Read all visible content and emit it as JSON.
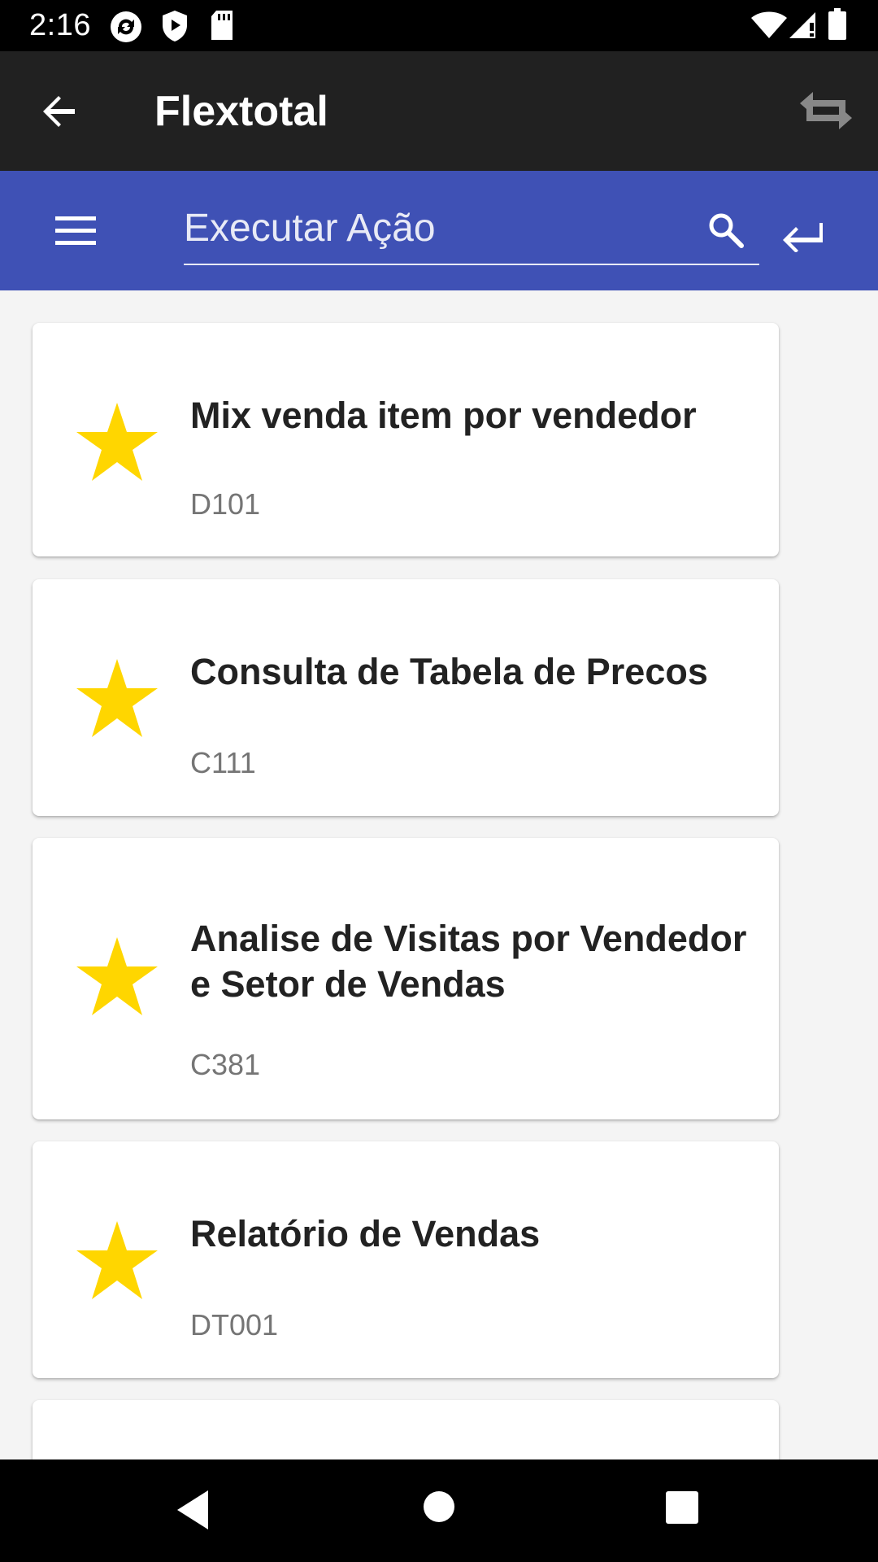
{
  "status_bar": {
    "time": "2:16",
    "left_icons": [
      "sync-app-icon",
      "shield-icon",
      "sd-card-icon"
    ],
    "right_icons": [
      "wifi-icon",
      "signal-icon",
      "battery-icon"
    ]
  },
  "app_bar": {
    "title": "Flextotal",
    "back_icon": "arrow-left-icon",
    "sync_icon": "sync-icon"
  },
  "search_bar": {
    "placeholder": "Executar Ação",
    "value": "",
    "menu_icon": "hamburger-menu-icon",
    "search_icon": "search-icon",
    "enter_icon": "keyboard-return-icon"
  },
  "items": [
    {
      "title": "Mix venda item por vendedor",
      "code": "D101",
      "icon": "star-icon"
    },
    {
      "title": "Consulta de Tabela de Precos",
      "code": "C111",
      "icon": "star-icon"
    },
    {
      "title": "Analise de Visitas por Vendedor e Setor de Vendas",
      "code": "C381",
      "icon": "star-icon"
    },
    {
      "title": "Relatório de Vendas",
      "code": "DT001",
      "icon": "star-icon"
    }
  ],
  "colors": {
    "app_bar": "#212121",
    "search_bar": "#3f51b5",
    "star": "#ffd600",
    "background": "#f4f4f4"
  },
  "nav_bar": {
    "buttons": [
      "back-triangle-icon",
      "home-circle-icon",
      "recents-square-icon"
    ]
  }
}
